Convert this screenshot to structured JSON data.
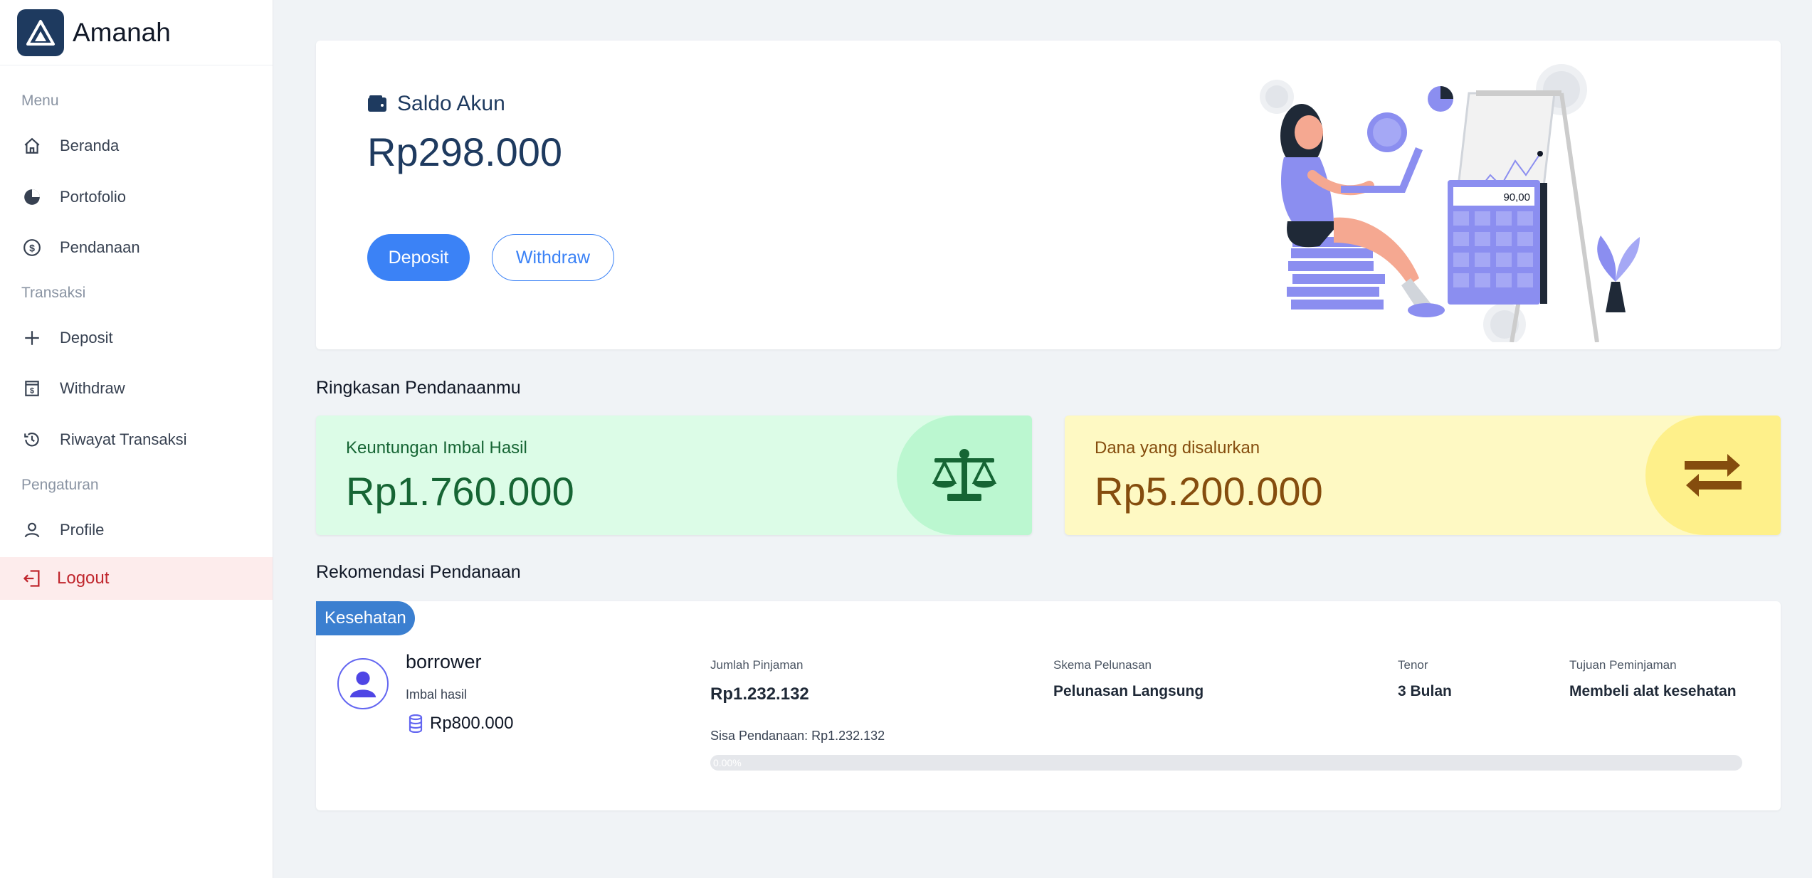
{
  "app": {
    "name": "Amanah"
  },
  "sidebar": {
    "sections": [
      {
        "label": "Menu"
      },
      {
        "label": "Transaksi"
      },
      {
        "label": "Pengaturan"
      }
    ],
    "items": [
      {
        "label": "Beranda",
        "icon": "home-icon"
      },
      {
        "label": "Portofolio",
        "icon": "pie-chart-icon"
      },
      {
        "label": "Pendanaan",
        "icon": "dollar-coin-icon"
      },
      {
        "label": "Deposit",
        "icon": "plus-icon"
      },
      {
        "label": "Withdraw",
        "icon": "withdraw-bill-icon"
      },
      {
        "label": "Riwayat Transaksi",
        "icon": "history-icon"
      },
      {
        "label": "Profile",
        "icon": "user-icon"
      }
    ],
    "logout": {
      "label": "Logout",
      "icon": "logout-icon"
    }
  },
  "balance": {
    "title": "Saldo Akun",
    "amount": "Rp298.000",
    "deposit_label": "Deposit",
    "withdraw_label": "Withdraw",
    "illustration_calculator_display": "90,00"
  },
  "summary": {
    "heading": "Ringkasan Pendanaanmu",
    "cards": [
      {
        "label": "Keuntungan Imbal Hasil",
        "value": "Rp1.760.000",
        "icon": "scale-icon"
      },
      {
        "label": "Dana yang disalurkan",
        "value": "Rp5.200.000",
        "icon": "transfer-arrows-icon"
      }
    ]
  },
  "recommendation": {
    "heading": "Rekomendasi Pendanaan",
    "category": "Kesehatan",
    "borrower": "borrower",
    "imbal_label": "Imbal hasil",
    "imbal_value": "Rp800.000",
    "columns": [
      {
        "label": "Jumlah Pinjaman",
        "value": "Rp1.232.132"
      },
      {
        "label": "Skema Pelunasan",
        "value": "Pelunasan Langsung"
      },
      {
        "label": "Tenor",
        "value": "3 Bulan"
      },
      {
        "label": "Tujuan Peminjaman",
        "value": "Membeli alat kesehatan"
      }
    ],
    "sisa_label": "Sisa Pendanaan: Rp1.232.132",
    "progress": {
      "text": "0.00%",
      "fraction": 0.0
    }
  },
  "colors": {
    "accent": "#3b82f6",
    "brand": "#1e3a5f",
    "green_bg": "#dcfce7",
    "yellow_bg": "#fef9c3",
    "logout": "#c0262d"
  }
}
